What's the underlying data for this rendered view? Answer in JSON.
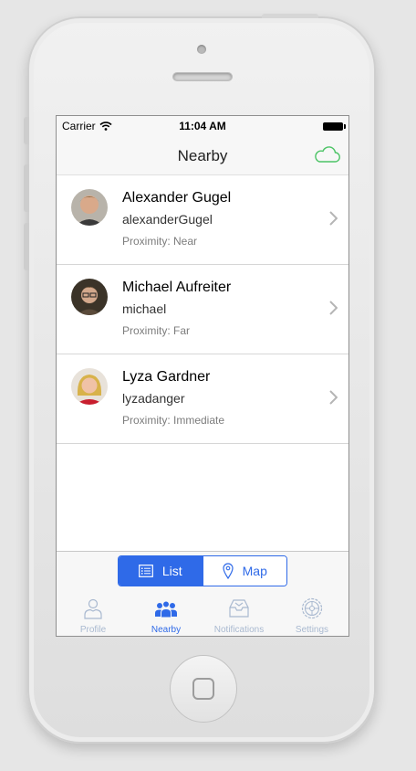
{
  "status_bar": {
    "carrier": "Carrier",
    "time": "11:04 AM"
  },
  "nav": {
    "title": "Nearby",
    "action_icon": "cloud-icon"
  },
  "people": [
    {
      "name": "Alexander Gugel",
      "username": "alexanderGugel",
      "proximity": "Proximity: Near"
    },
    {
      "name": "Michael Aufreiter",
      "username": "michael",
      "proximity": "Proximity: Far"
    },
    {
      "name": "Lyza Gardner",
      "username": "lyzadanger",
      "proximity": "Proximity: Immediate"
    }
  ],
  "segment": {
    "list_label": "List",
    "map_label": "Map",
    "selected": "List"
  },
  "tabs": [
    {
      "label": "Profile",
      "icon": "person-icon",
      "active": false
    },
    {
      "label": "Nearby",
      "icon": "group-icon",
      "active": true
    },
    {
      "label": "Notifications",
      "icon": "inbox-icon",
      "active": false
    },
    {
      "label": "Settings",
      "icon": "gear-icon",
      "active": false
    }
  ],
  "colors": {
    "accent": "#2f6ae8",
    "inactive_tab": "#a9b9d0",
    "cloud": "#4cc466"
  }
}
